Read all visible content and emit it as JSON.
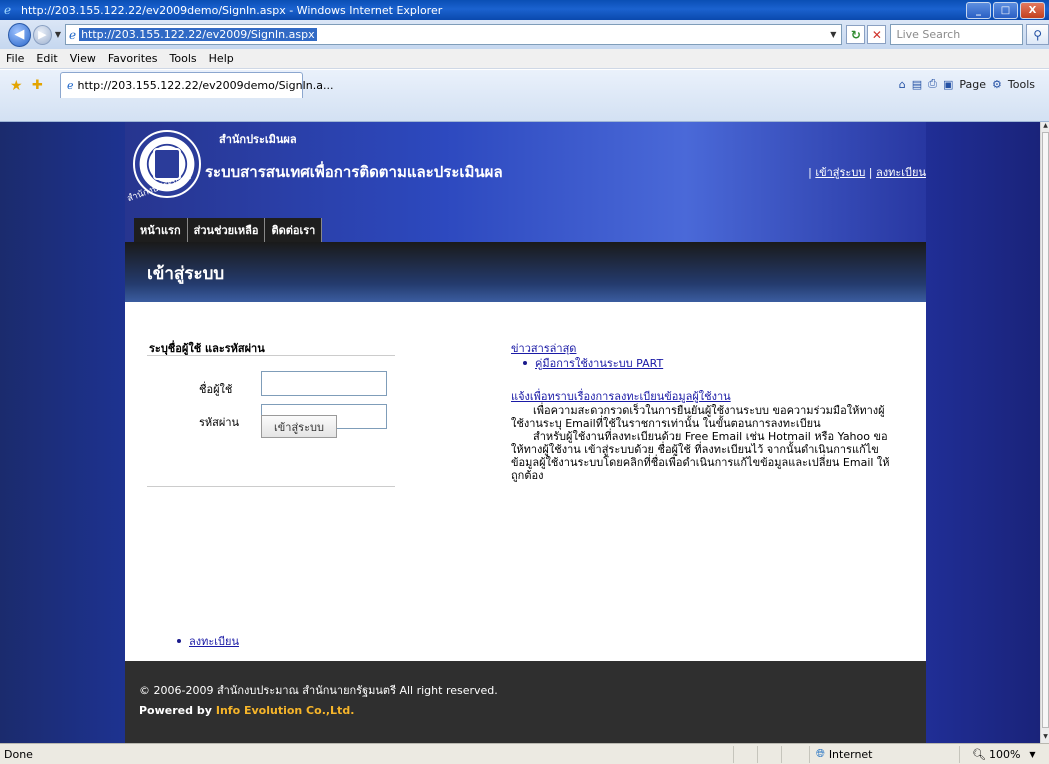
{
  "window": {
    "title": "http://203.155.122.22/ev2009demo/SignIn.aspx - Windows Internet Explorer",
    "minimize": "_",
    "maximize": "□",
    "close": "X"
  },
  "addressbar": {
    "url": "http://203.155.122.22/ev2009/SignIn.aspx",
    "search_placeholder": "Live Search"
  },
  "menu": [
    "File",
    "Edit",
    "View",
    "Favorites",
    "Tools",
    "Help"
  ],
  "tabbar": {
    "tab_title": "http://203.155.122.22/ev2009demo/SignIn.a...",
    "page_label": "Page",
    "tools_label": "Tools"
  },
  "site": {
    "org_label": "สำนักประเมินผล",
    "system_title": "ระบบสารสนเทศเพื่อการติดตามและประเมินผล",
    "seal_text": "สำนักงบประมาณ",
    "header_sep": "|",
    "header_links": {
      "login": "เข้าสู่ระบบ",
      "register": "ลงทะเบียน"
    },
    "nav": [
      "หน้าแรก",
      "ส่วนช่วยเหลือ",
      "ติดต่อเรา"
    ],
    "banner_title": "เข้าสู่ระบบ",
    "login": {
      "heading": "ระบุชื่อผู้ใช้ และรหัสผ่าน",
      "username_label": "ชื่อผู้ใช้",
      "password_label": "รหัสผ่าน",
      "username_value": "",
      "password_value": "",
      "submit": "เข้าสู่ระบบ",
      "register_link": "ลงทะเบียน"
    },
    "news": {
      "heading": "ข่าวสารล่าสุด",
      "items": [
        "คู่มือการใช้งานระบบ PART"
      ]
    },
    "announcement": {
      "title": "แจ้งเพื่อทราบเรื่องการลงทะเบียนข้อมูลผู้ใช้งาน",
      "para1": "เพื่อความสะดวกรวดเร็วในการยืนยันผู้ใช้งานระบบ ขอความร่วมมือให้ทางผู้ใช้งานระบุ Emailที่ใช้ในราชการเท่านั้น ในขั้นตอนการลงทะเบียน",
      "para2": "สำหรับผู้ใช้งานที่ลงทะเบียนด้วย Free Email เช่น Hotmail หรือ Yahoo ขอให้ทางผู้ใช้งาน เข้าสู่ระบบด้วย ชื่อผู้ใช้ ที่ลงทะเบียนไว้ จากนั้นดำเนินการแก้ไขข้อมูลผู้ใช้งานระบบโดยคลิกที่ชื่อเพื่อดำเนินการแก้ไขข้อมูลและเปลี่ยน Email ให้ถูกต้อง"
    },
    "footer": {
      "copyright": "© 2006-2009 สำนักงบประมาณ สำนักนายกรัฐมนตรี All right reserved.",
      "powered_label": "Powered by",
      "powered_brand": "Info Evolution Co.,Ltd."
    }
  },
  "statusbar": {
    "status": "Done",
    "zone": "Internet",
    "zoom": "100%"
  },
  "colors": {
    "header_blue": "#2d49bf",
    "nav_dark": "#1e1e1e",
    "footer_dark": "#2f2f2f",
    "brand_orange": "#f6b52a",
    "link_blue": "#1a1aa6"
  }
}
